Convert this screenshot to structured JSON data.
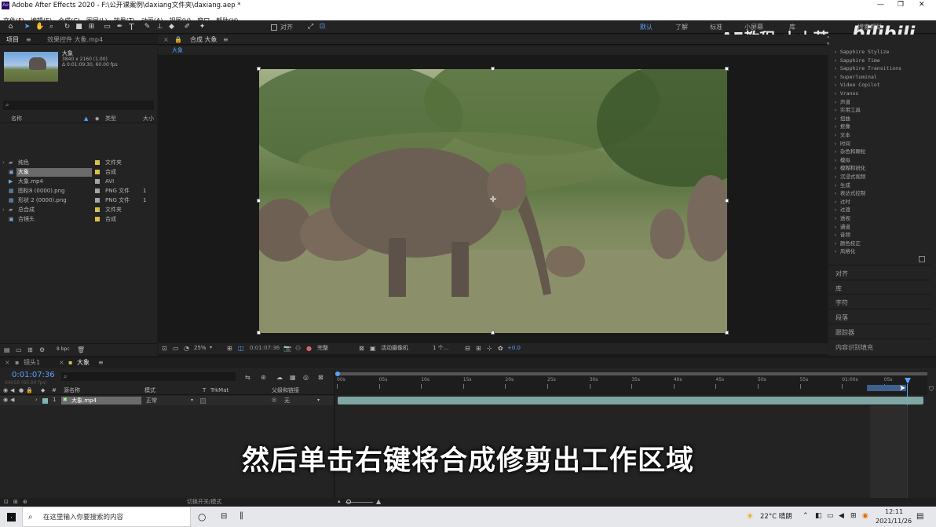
{
  "window": {
    "title": "Adobe After Effects 2020 - F:\\公开课案例\\daxiang文件夹\\daxiang.aep *",
    "controls": [
      "—",
      "❐",
      "✕"
    ]
  },
  "menu": [
    "文件(F)",
    "编辑(E)",
    "合成(C)",
    "图层(L)",
    "效果(T)",
    "动画(A)",
    "视图(V)",
    "窗口",
    "帮助(H)"
  ],
  "toolbar": {
    "snap_label": "对齐",
    "workspaces": [
      "默认",
      "了解",
      "标准",
      "小屏幕",
      "库"
    ],
    "search_placeholder": "搜索帮助"
  },
  "watermark": {
    "text": "AE教程-小小茂",
    "logo": "bilibili"
  },
  "project": {
    "tab": "项目",
    "tab2": "效果控件 大象.mp4",
    "selected_name": "大象",
    "selected_info1": "3840 x 2160 (1.00)",
    "selected_info2": "Δ 0:01:09:30, 60.00 fps",
    "search_placeholder": "",
    "col_name": "名称",
    "col_type": "类型",
    "col_size": "大小",
    "items": [
      {
        "name": "纯色",
        "type": "文件夹",
        "size": "",
        "color": "#d6c24a",
        "kind": "folder"
      },
      {
        "name": "大象",
        "type": "合成",
        "size": "",
        "color": "#d6c24a",
        "kind": "comp"
      },
      {
        "name": "大象.mp4",
        "type": "AVI",
        "size": "",
        "color": "#a6a6a6",
        "kind": "video"
      },
      {
        "name": "图标8 (0000).png",
        "type": "PNG 文件",
        "size": "1",
        "color": "#a6a6a6",
        "kind": "image"
      },
      {
        "name": "形状 2 (0000).png",
        "type": "PNG 文件",
        "size": "1",
        "color": "#a6a6a6",
        "kind": "image"
      },
      {
        "name": "总合成",
        "type": "文件夹",
        "size": "",
        "color": "#d6c24a",
        "kind": "folder"
      },
      {
        "name": "合镜头",
        "type": "合成",
        "size": "",
        "color": "#d6c24a",
        "kind": "comp"
      }
    ],
    "bpc": "8 bpc"
  },
  "composition": {
    "tab": "合成 大象",
    "breadcrumb": "大象",
    "zoom": "25%",
    "time": "0:01:07:36",
    "resolution": "完整",
    "camera": "活动摄像机",
    "views": "1 个...",
    "exposure": "+0.0"
  },
  "effects_panel": {
    "items": [
      "Sapphire Stylize",
      "Sapphire Time",
      "Sapphire Transitions",
      "Superluminal",
      "Video Copilot",
      "Vranos",
      "声道",
      "实用工具",
      "扭曲",
      "抠像",
      "文本",
      "时间",
      "杂色和颗粒",
      "模拟",
      "模糊和锐化",
      "沉浸式视频",
      "生成",
      "表达式控制",
      "过时",
      "过渡",
      "透视",
      "通道",
      "音频",
      "颜色校正",
      "风格化"
    ]
  },
  "side_panels": [
    "对齐",
    "库",
    "字符",
    "段落",
    "跟踪器",
    "内容识别填充"
  ],
  "timeline": {
    "tabs": [
      "镜头1",
      "大象"
    ],
    "current_time": "0:01:07:36",
    "frame_info": "04056 (60.00 fps)",
    "search_placeholder": "",
    "col_source": "源名称",
    "col_mode": "模式",
    "col_t": "T",
    "col_trkmat": "TrkMat",
    "col_parent": "父级和链接",
    "ruler": [
      "00s",
      "05s",
      "10s",
      "15s",
      "20s",
      "25s",
      "30s",
      "35s",
      "40s",
      "45s",
      "50s",
      "55s",
      "01:00s",
      "05s"
    ],
    "layer": {
      "index": "1",
      "name": "大象.mp4",
      "mode": "正常",
      "parent": "无"
    },
    "footer": "切换开关/模式"
  },
  "subtitle": "然后单击右键将合成修剪出工作区域",
  "taskbar": {
    "search_placeholder": "在这里输入你要搜索的内容",
    "weather": "22°C 晴朗",
    "time": "12:11",
    "date": "2021/11/26"
  }
}
